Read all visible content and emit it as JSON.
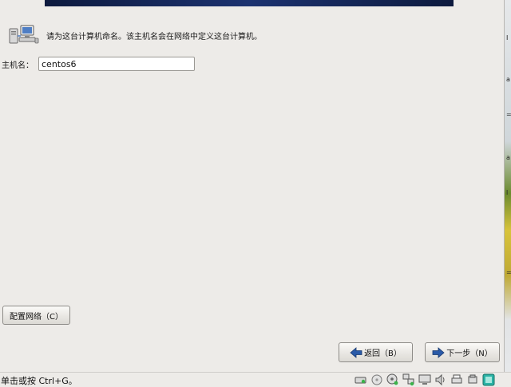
{
  "header": {
    "note": "请为这台计算机命名。该主机名会在网络中定义这台计算机。"
  },
  "hostname": {
    "label": "主机名：",
    "value": "centos6"
  },
  "buttons": {
    "configure_network": "配置网络（C）",
    "back": "返回（B）",
    "next": "下一步（N）"
  },
  "status": {
    "hint": "单击或按 Ctrl+G。"
  },
  "tray_icons": [
    "hard-disk-icon",
    "optical-drive-icon",
    "cd-icon",
    "network-icon",
    "display-icon",
    "audio-icon",
    "printer-icon",
    "usb-icon",
    "vm-icon"
  ],
  "colors": {
    "background": "#edebe8",
    "banner": "#1c3270",
    "arrow": "#2a5aa8"
  }
}
